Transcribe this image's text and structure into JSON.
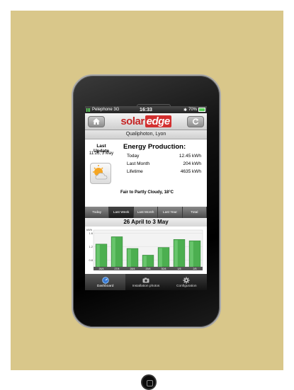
{
  "status_bar": {
    "carrier": "Pelephone 3G",
    "time": "16:33",
    "bluetooth": "✱",
    "battery": "70%"
  },
  "header": {
    "logo_left": "solar",
    "logo_right": "edge",
    "home_icon": "home-icon",
    "refresh_icon": "refresh-icon"
  },
  "site": {
    "name": "Qualiphoton, Lyon"
  },
  "last_update": {
    "title": "Last Update",
    "time": "11:25, 3 May"
  },
  "energy": {
    "title": "Energy Production:",
    "rows": [
      {
        "label": "Today",
        "value": "12.45 kWh"
      },
      {
        "label": "Last Month",
        "value": "204 kWh"
      },
      {
        "label": "Lifetime",
        "value": "4635 kWh"
      }
    ],
    "forecast": "Fair to Partly Cloudy, 18°C"
  },
  "tabs": [
    {
      "label": "Today",
      "active": false
    },
    {
      "label": "Last Week",
      "active": true
    },
    {
      "label": "Last Month",
      "active": false
    },
    {
      "label": "Last Year",
      "active": false
    },
    {
      "label": "Total",
      "active": false
    }
  ],
  "chart_title": "26 April to 3 May",
  "chart_data": {
    "type": "bar",
    "ylabel": "kWh",
    "yticks": [
      "1.6",
      "1.2",
      "0.8"
    ],
    "categories": [
      "26/4",
      "27/4",
      "28/4",
      "29/4",
      "30/4",
      "1/5",
      "2/5"
    ],
    "values": [
      1.28,
      1.5,
      1.15,
      0.95,
      1.18,
      1.42,
      1.38
    ],
    "ylim": [
      0.6,
      1.7
    ],
    "color": "#4caf50"
  },
  "tabbar": [
    {
      "label": "Dashboard",
      "icon": "dashboard-icon",
      "active": true
    },
    {
      "label": "Installation photos",
      "icon": "camera-icon",
      "active": false
    },
    {
      "label": "Configuration",
      "icon": "gear-icon",
      "active": false
    }
  ]
}
